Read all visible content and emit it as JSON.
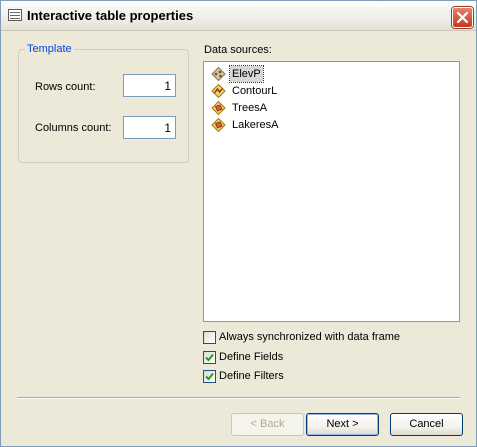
{
  "window": {
    "title": "Interactive table properties"
  },
  "template": {
    "legend": "Template",
    "rows_label": "Rows count:",
    "rows_value": "1",
    "columns_label": "Columns count:",
    "columns_value": "1"
  },
  "data_sources": {
    "label": "Data sources:",
    "items": [
      {
        "label": "ElevP",
        "icon": "point-layer-icon",
        "selected": true
      },
      {
        "label": "ContourL",
        "icon": "line-layer-icon",
        "selected": false
      },
      {
        "label": "TreesA",
        "icon": "polygon-layer-icon",
        "selected": false
      },
      {
        "label": "LakeresA",
        "icon": "polygon-layer-icon",
        "selected": false
      }
    ]
  },
  "options": {
    "always_sync": {
      "label": "Always synchronized with data frame",
      "checked": false
    },
    "define_fields": {
      "label": "Define Fields",
      "checked": true
    },
    "define_filters": {
      "label": "Define Filters",
      "checked": true
    }
  },
  "buttons": {
    "back": "< Back",
    "next": "Next >",
    "cancel": "Cancel"
  },
  "colors": {
    "accent": "#0046d5",
    "dialog_bg": "#ece9d8",
    "close_red": "#c4381c"
  }
}
